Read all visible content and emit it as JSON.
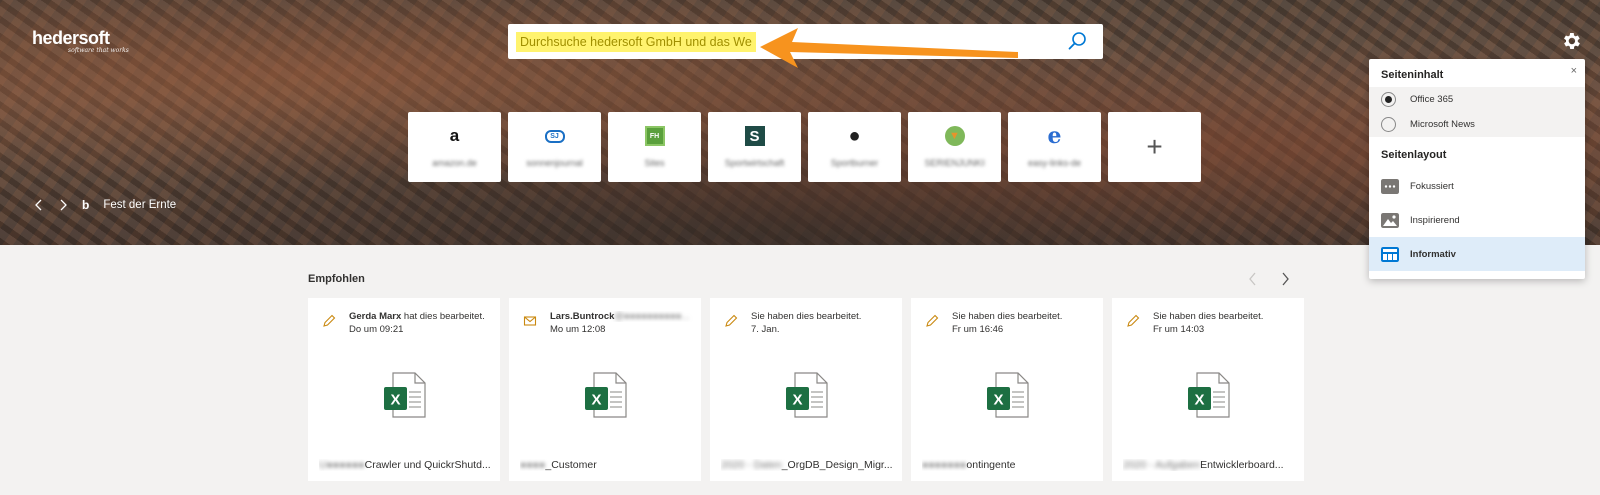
{
  "brand": {
    "logo_text": "hedersoft",
    "logo_tagline": "software that works"
  },
  "search": {
    "placeholder": "Durchsuche hedersoft GmbH und das Web"
  },
  "tiles": [
    {
      "icon_glyph": "a",
      "label": "amazon.de"
    },
    {
      "icon_glyph": "SJ",
      "label": "sonnenjournal"
    },
    {
      "icon_glyph": "FH",
      "label": "Sites"
    },
    {
      "icon_glyph": "S",
      "label": "Sportwirtschaft"
    },
    {
      "icon_glyph": "●",
      "label": "Sportburner"
    },
    {
      "icon_glyph": "▼",
      "label": "SERIENJUNKIE"
    },
    {
      "icon_glyph": "e",
      "label": "easy-links-de"
    }
  ],
  "add_tile_symbol": "+",
  "bing": {
    "logo": "b",
    "caption": "Fest der Ernte"
  },
  "recommended": {
    "title": "Empfohlen",
    "cards": [
      {
        "activity": "edit",
        "who": "Gerda Marx",
        "action": " hat dies bearbeitet.",
        "when": "Do um 09:21",
        "name_hidden": "U●●●●●● ",
        "name": "Crawler und QuickrShutd..."
      },
      {
        "activity": "mail",
        "who": "Lars.Buntrock",
        "action": "@●●●●●●●●●●...",
        "when": "Mo um 12:08",
        "name_hidden": "●●●●",
        "name": "_Customer"
      },
      {
        "activity": "edit",
        "who": "",
        "action": "Sie haben dies bearbeitet.",
        "when": "7. Jan.",
        "name_hidden": "2020 - Daten",
        "name": "_OrgDB_Design_Migr..."
      },
      {
        "activity": "edit",
        "who": "",
        "action": "Sie haben dies bearbeitet.",
        "when": "Fr um 16:46",
        "name_hidden": "●●●●●●●",
        "name": "ontingente"
      },
      {
        "activity": "edit",
        "who": "",
        "action": "Sie haben dies bearbeitet.",
        "when": "Fr um 14:03",
        "name_hidden": "2020 - Aufgaben ",
        "name": "Entwicklerboard..."
      }
    ]
  },
  "settings": {
    "close_symbol": "×",
    "content_heading": "Seiteninhalt",
    "content_options": [
      {
        "label": "Office 365",
        "selected": true
      },
      {
        "label": "Microsoft News",
        "selected": false
      }
    ],
    "layout_heading": "Seitenlayout",
    "layout_options": [
      {
        "label": "Fokussiert",
        "selected": false
      },
      {
        "label": "Inspirierend",
        "selected": false
      },
      {
        "label": "Informativ",
        "selected": true
      }
    ]
  },
  "colors": {
    "accent": "#0078d4",
    "excel_green": "#1d6f42",
    "annotation_arrow": "#f7931e",
    "highlight": "#fff36e"
  }
}
